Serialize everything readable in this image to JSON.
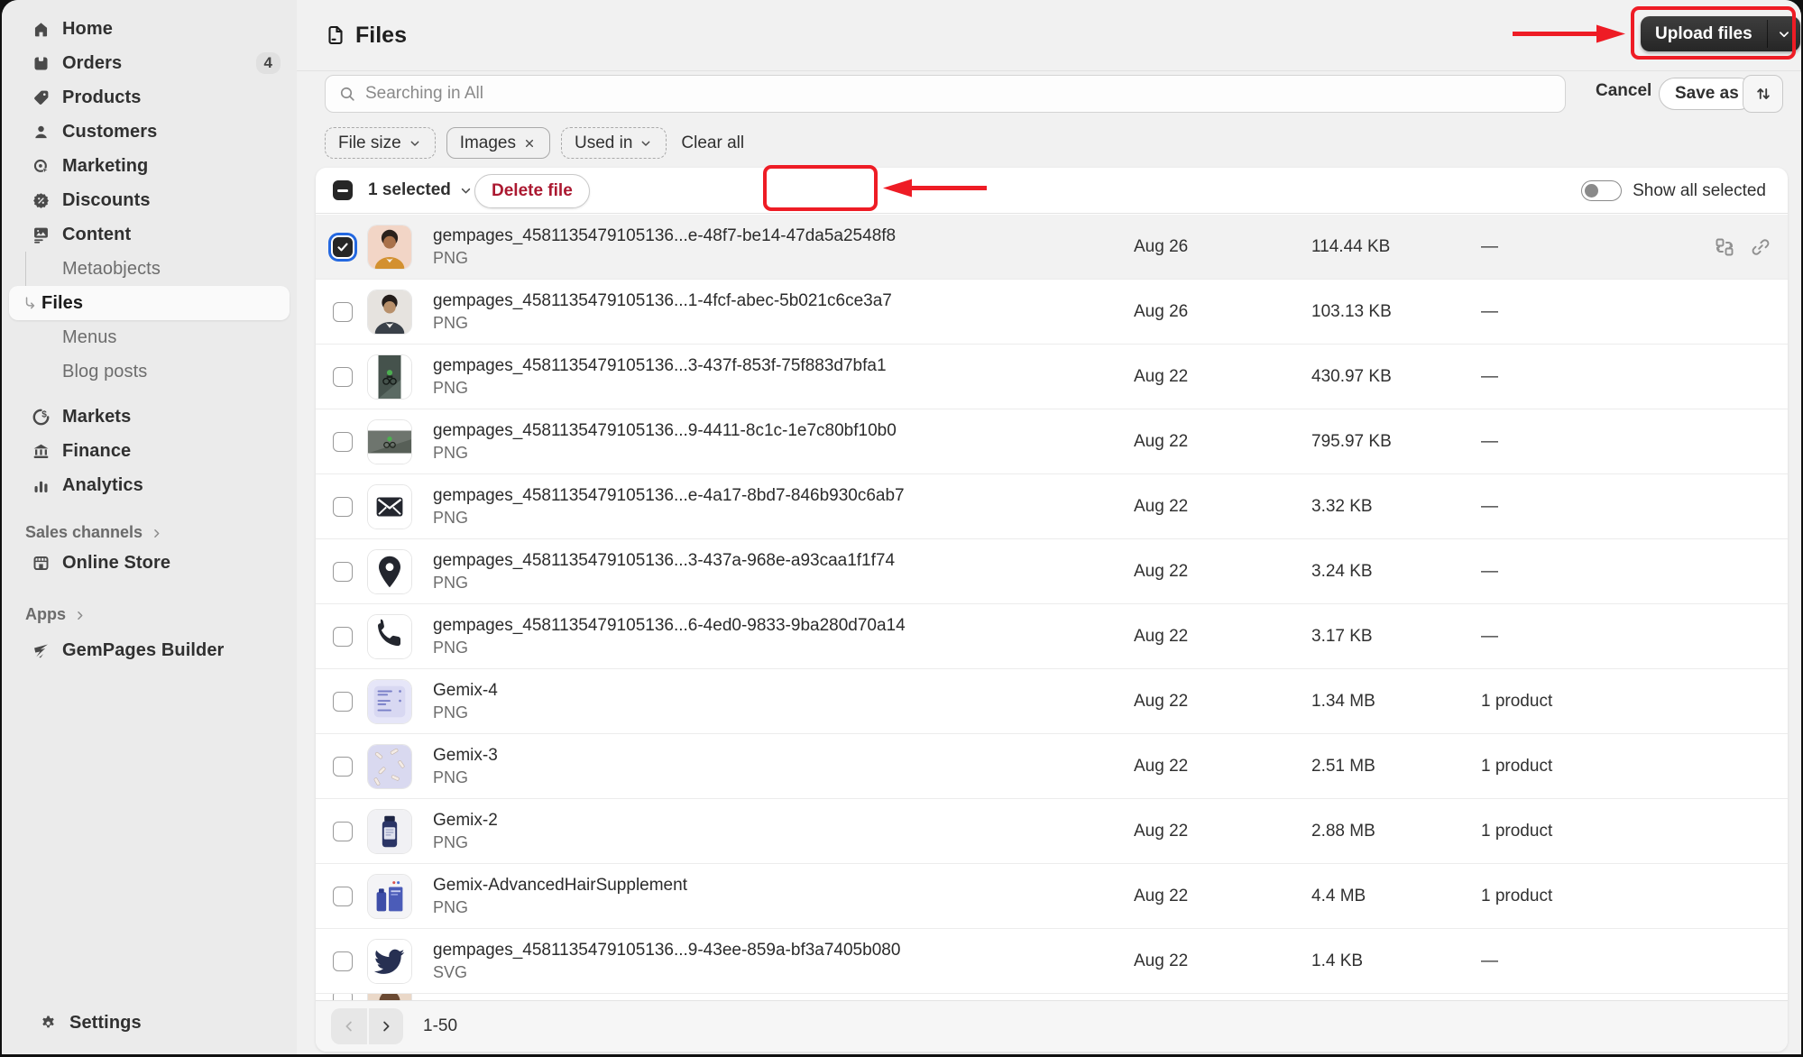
{
  "sidebar": {
    "nav": [
      {
        "type": "item",
        "label": "Home",
        "icon": "home"
      },
      {
        "type": "item",
        "label": "Orders",
        "icon": "orders",
        "badge": "4"
      },
      {
        "type": "item",
        "label": "Products",
        "icon": "products"
      },
      {
        "type": "item",
        "label": "Customers",
        "icon": "customers"
      },
      {
        "type": "item",
        "label": "Marketing",
        "icon": "marketing"
      },
      {
        "type": "item",
        "label": "Discounts",
        "icon": "discounts"
      },
      {
        "type": "item",
        "label": "Content",
        "icon": "content"
      },
      {
        "type": "sub",
        "label": "Metaobjects"
      },
      {
        "type": "sub",
        "label": "Files",
        "active": true
      },
      {
        "type": "sub",
        "label": "Menus"
      },
      {
        "type": "sub",
        "label": "Blog posts"
      },
      {
        "type": "item",
        "label": "Markets",
        "icon": "markets",
        "gap": "gap12"
      },
      {
        "type": "item",
        "label": "Finance",
        "icon": "finance"
      },
      {
        "type": "item",
        "label": "Analytics",
        "icon": "analytics"
      },
      {
        "type": "section",
        "label": "Sales channels",
        "gap": "gap18"
      },
      {
        "type": "item",
        "label": "Online Store",
        "icon": "online-store"
      },
      {
        "type": "section",
        "label": "Apps",
        "gap": "gap23"
      },
      {
        "type": "item",
        "label": "GemPages Builder",
        "icon": "gempages",
        "gap": "gap6"
      }
    ],
    "settings_label": "Settings"
  },
  "header": {
    "title": "Files",
    "upload_label": "Upload files"
  },
  "search": {
    "placeholder": "Searching in All",
    "cancel_label": "Cancel",
    "save_as_label": "Save as"
  },
  "filters": {
    "chips": [
      {
        "label": "File size",
        "kind": "dropdown"
      },
      {
        "label": "Images",
        "kind": "removable"
      },
      {
        "label": "Used in",
        "kind": "dropdown"
      }
    ],
    "clear_all_label": "Clear all"
  },
  "selection": {
    "count_label": "1 selected",
    "delete_label": "Delete file",
    "show_all_label": "Show all selected"
  },
  "files": [
    {
      "name": "gempages_4581135479105136...e-48f7-be14-47da5a2548f8",
      "type": "PNG",
      "date": "Aug 26",
      "size": "114.44 KB",
      "used": "—",
      "thumb": "photo-man-orange",
      "selected": true,
      "actions": [
        "replace",
        "link"
      ]
    },
    {
      "name": "gempages_4581135479105136...1-4fcf-abec-5b021c6ce3a7",
      "type": "PNG",
      "date": "Aug 26",
      "size": "103.13 KB",
      "used": "—",
      "thumb": "photo-man-jacket"
    },
    {
      "name": "gempages_4581135479105136...3-437f-853f-75f883d7bfa1",
      "type": "PNG",
      "date": "Aug 22",
      "size": "430.97 KB",
      "used": "—",
      "thumb": "photo-cyclist-portrait"
    },
    {
      "name": "gempages_4581135479105136...9-4411-8c1c-1e7c80bf10b0",
      "type": "PNG",
      "date": "Aug 22",
      "size": "795.97 KB",
      "used": "—",
      "thumb": "photo-cyclist-landscape"
    },
    {
      "name": "gempages_4581135479105136...e-4a17-8bd7-846b930c6ab7",
      "type": "PNG",
      "date": "Aug 22",
      "size": "3.32 KB",
      "used": "—",
      "thumb": "icon-envelope"
    },
    {
      "name": "gempages_4581135479105136...3-437a-968e-a93caa1f1f74",
      "type": "PNG",
      "date": "Aug 22",
      "size": "3.24 KB",
      "used": "—",
      "thumb": "icon-location-pin"
    },
    {
      "name": "gempages_4581135479105136...6-4ed0-9833-9ba280d70a14",
      "type": "PNG",
      "date": "Aug 22",
      "size": "3.17 KB",
      "used": "—",
      "thumb": "icon-phone"
    },
    {
      "name": "Gemix-4",
      "type": "PNG",
      "date": "Aug 22",
      "size": "1.34 MB",
      "used": "1 product",
      "thumb": "card-gemix-4"
    },
    {
      "name": "Gemix-3",
      "type": "PNG",
      "date": "Aug 22",
      "size": "2.51 MB",
      "used": "1 product",
      "thumb": "pattern-gemix-3"
    },
    {
      "name": "Gemix-2",
      "type": "PNG",
      "date": "Aug 22",
      "size": "2.88 MB",
      "used": "1 product",
      "thumb": "bottle-gemix-2"
    },
    {
      "name": "Gemix-AdvancedHairSupplement",
      "type": "PNG",
      "date": "Aug 22",
      "size": "4.4 MB",
      "used": "1 product",
      "thumb": "box-gemix-hair"
    },
    {
      "name": "gempages_4581135479105136...9-43ee-859a-bf3a7405b080",
      "type": "SVG",
      "date": "Aug 22",
      "size": "1.4 KB",
      "used": "—",
      "thumb": "icon-twitter"
    },
    {
      "partial": true,
      "thumb": "photo-partial"
    }
  ],
  "pagination": {
    "range_label": "1-50"
  },
  "colors": {
    "annotation_red": "#ee1c25",
    "selected_row": "#f2f2f2",
    "primary_text": "#303030",
    "secondary_text": "#6d6d6d",
    "critical_text": "#ab1830",
    "dark_button": "#2e2e2e",
    "focus_ring_blue": "#2468e0"
  }
}
